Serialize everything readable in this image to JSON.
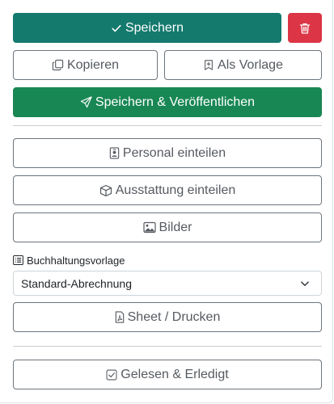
{
  "actions": {
    "save_label": "Speichern",
    "copy_label": "Kopieren",
    "template_label": "Als Vorlage",
    "save_publish_label": "Speichern & Veröffentlichen"
  },
  "assign": {
    "staff_label": "Personal einteilen",
    "equipment_label": "Ausstattung einteilen",
    "images_label": "Bilder"
  },
  "accounting": {
    "label": "Buchhaltungsvorlage",
    "selected": "Standard-Abrechnung"
  },
  "sheet_label": "Sheet / Drucken",
  "read_done_label": "Gelesen & Erledigt",
  "colors": {
    "primary_teal": "#147a6e",
    "danger_red": "#dc3545",
    "success_green": "#198754",
    "outline_gray": "#6c757d"
  },
  "icons": {
    "save": "check-icon",
    "delete": "trash-icon",
    "copy": "copy-icon",
    "template": "bookmark-plus-icon",
    "publish": "send-icon",
    "staff": "person-badge-icon",
    "equipment": "box-icon",
    "images": "images-icon",
    "accounting": "list-icon",
    "select": "chevron-down-icon",
    "sheet": "file-pdf-icon",
    "read_done": "check-square-icon"
  }
}
